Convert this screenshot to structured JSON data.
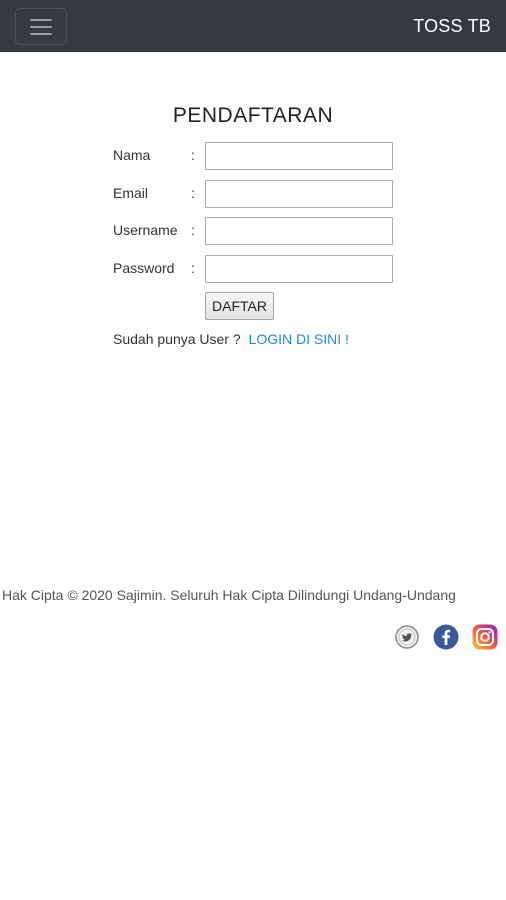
{
  "navbar": {
    "brand": "TOSS TB",
    "menu_icon": "hamburger-icon"
  },
  "form": {
    "title": "PENDAFTARAN",
    "fields": [
      {
        "label": "Nama",
        "colon": ":",
        "value": "",
        "placeholder": ""
      },
      {
        "label": "Email",
        "colon": ":",
        "value": "",
        "placeholder": ""
      },
      {
        "label": "Username",
        "colon": ":",
        "value": "",
        "placeholder": ""
      },
      {
        "label": "Password",
        "colon": ":",
        "value": "",
        "placeholder": ""
      }
    ],
    "submit_label": "DAFTAR",
    "login_prompt": "Sudah punya User ?",
    "login_link": "LOGIN DI SINI !"
  },
  "footer": {
    "copyright": "Hak Cipta © 2020 Sajimin. Seluruh Hak Cipta Dilindungi Undang-Undang",
    "social": [
      {
        "icon": "twitter-icon"
      },
      {
        "icon": "facebook-icon"
      },
      {
        "icon": "instagram-icon"
      }
    ]
  },
  "colors": {
    "navbar_bg": "#343a40",
    "link": "#1e88e5",
    "facebook": "#3b5998",
    "instagram_start": "#fdc830",
    "instagram_end": "#c13584"
  }
}
